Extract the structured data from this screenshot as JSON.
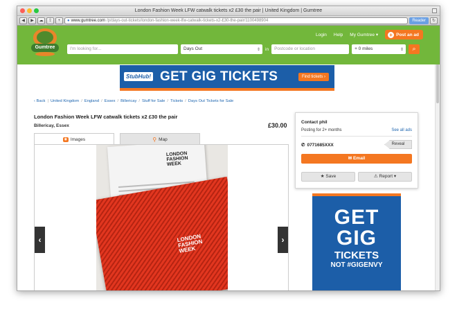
{
  "window": {
    "title": "London Fashion Week LFW catwalk tickets x2 £30 the pair | United Kingdom | Gumtree",
    "url_domain": "www.gumtree.com",
    "url_path": "/p/days-out-tickets/london-fashion-week-lfw-catwalk-tickets-x2-£30-the-pair/1100498904",
    "reader_label": "Reader"
  },
  "header": {
    "logo_text": "Gumtree",
    "login": "Login",
    "help": "Help",
    "my_gumtree": "My Gumtree",
    "post_ad": "Post an ad",
    "search_placeholder": "I'm looking for...",
    "category": "Days Out",
    "in_label": "in",
    "location_placeholder": "Postcode or location",
    "distance": "+ 0 miles",
    "colors": {
      "green": "#72b73b",
      "orange": "#f47721"
    }
  },
  "banner": {
    "brand": "StubHub!",
    "headline": "GET GIG TICKETS",
    "cta": "Find tickets ›"
  },
  "breadcrumb": [
    "‹ Back",
    "United Kingdom",
    "England",
    "Essex",
    "Billericay",
    "Stuff for Sale",
    "Tickets",
    "Days Out Tickets for Sale"
  ],
  "listing": {
    "title": "London Fashion Week LFW catwalk tickets x2 £30 the pair",
    "location": "Billericay, Essex",
    "price": "£30.00",
    "tabs": {
      "images": "Images",
      "map": "Map"
    },
    "photo_paper_title": "LONDON FASHION WEEK",
    "photo_card_text": "LONDON FASHION WEEK"
  },
  "contact": {
    "name": "Contact phil",
    "posting": "Posting for 2+ months",
    "see_all": "See all ads",
    "phone": "0771685XXX",
    "reveal": "Reveal",
    "email": "Email",
    "save": "Save",
    "report": "Report"
  },
  "side_ad": {
    "line1": "GET",
    "line2": "GIG",
    "line3": "TICKETS",
    "line4": "NOT #GIGENVY"
  }
}
